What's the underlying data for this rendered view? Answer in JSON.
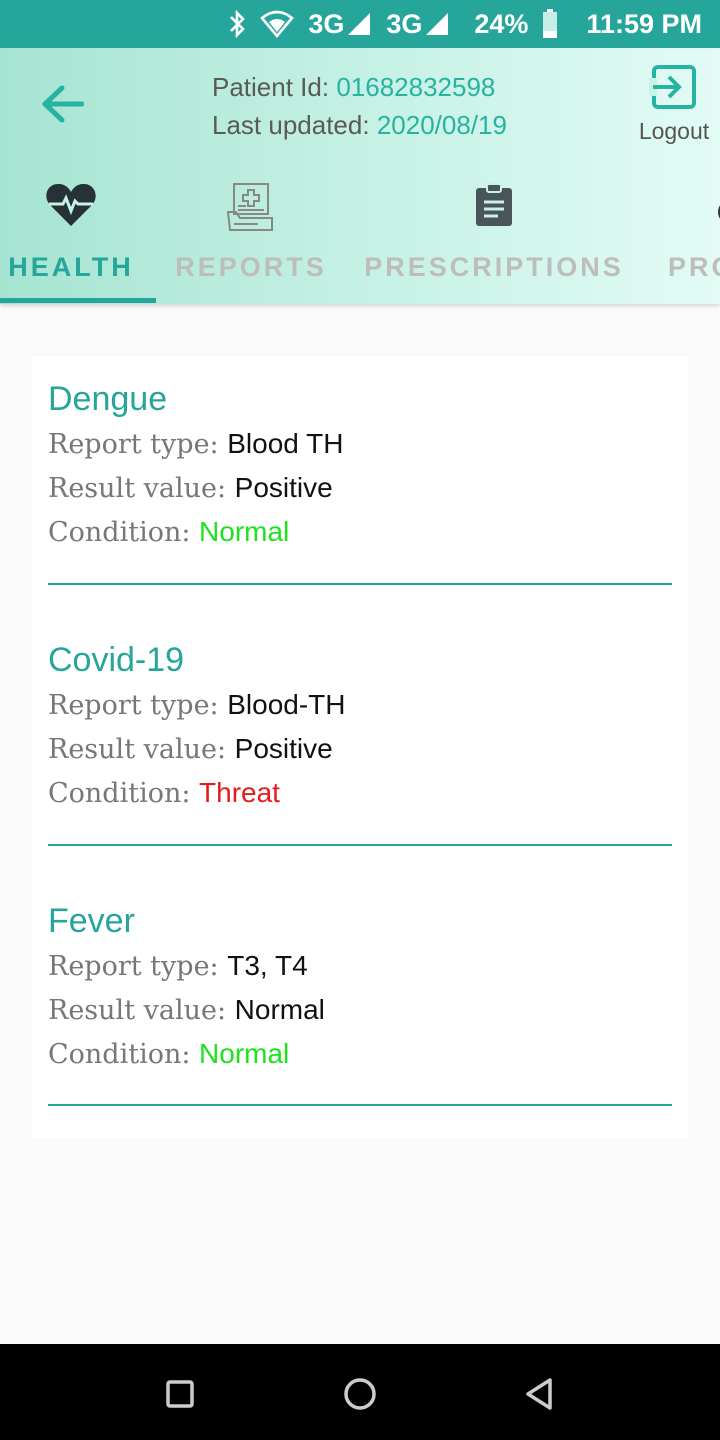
{
  "status_bar": {
    "network1": "3G",
    "network2": "3G",
    "battery": "24%",
    "time": "11:59 PM"
  },
  "header": {
    "patient_id_label": "Patient Id: ",
    "patient_id": "01682832598",
    "last_updated_label": "Last updated: ",
    "last_updated": "2020/08/19",
    "logout_label": "Logout"
  },
  "tabs": [
    {
      "label": "HEALTH",
      "icon": "heart-pulse-icon",
      "active": true
    },
    {
      "label": "REPORTS",
      "icon": "medical-report-icon",
      "active": false
    },
    {
      "label": "PRESCRIPTIONS",
      "icon": "clipboard-icon",
      "active": false
    },
    {
      "label": "PRO",
      "icon": "profile-icon",
      "active": false
    }
  ],
  "labels": {
    "report_type": "Report type: ",
    "result_value": "Result value: ",
    "condition": "Condition: "
  },
  "records": [
    {
      "title": "Dengue",
      "report_type": "Blood TH",
      "result_value": "Positive",
      "condition": "Normal"
    },
    {
      "title": "Covid-19",
      "report_type": "Blood-TH",
      "result_value": "Positive",
      "condition": "Threat"
    },
    {
      "title": "Fever",
      "report_type": "T3, T4",
      "result_value": "Normal",
      "condition": "Normal"
    }
  ],
  "colors": {
    "accent": "#26a69a",
    "normal": "#1de31d",
    "threat": "#e31b1b"
  }
}
